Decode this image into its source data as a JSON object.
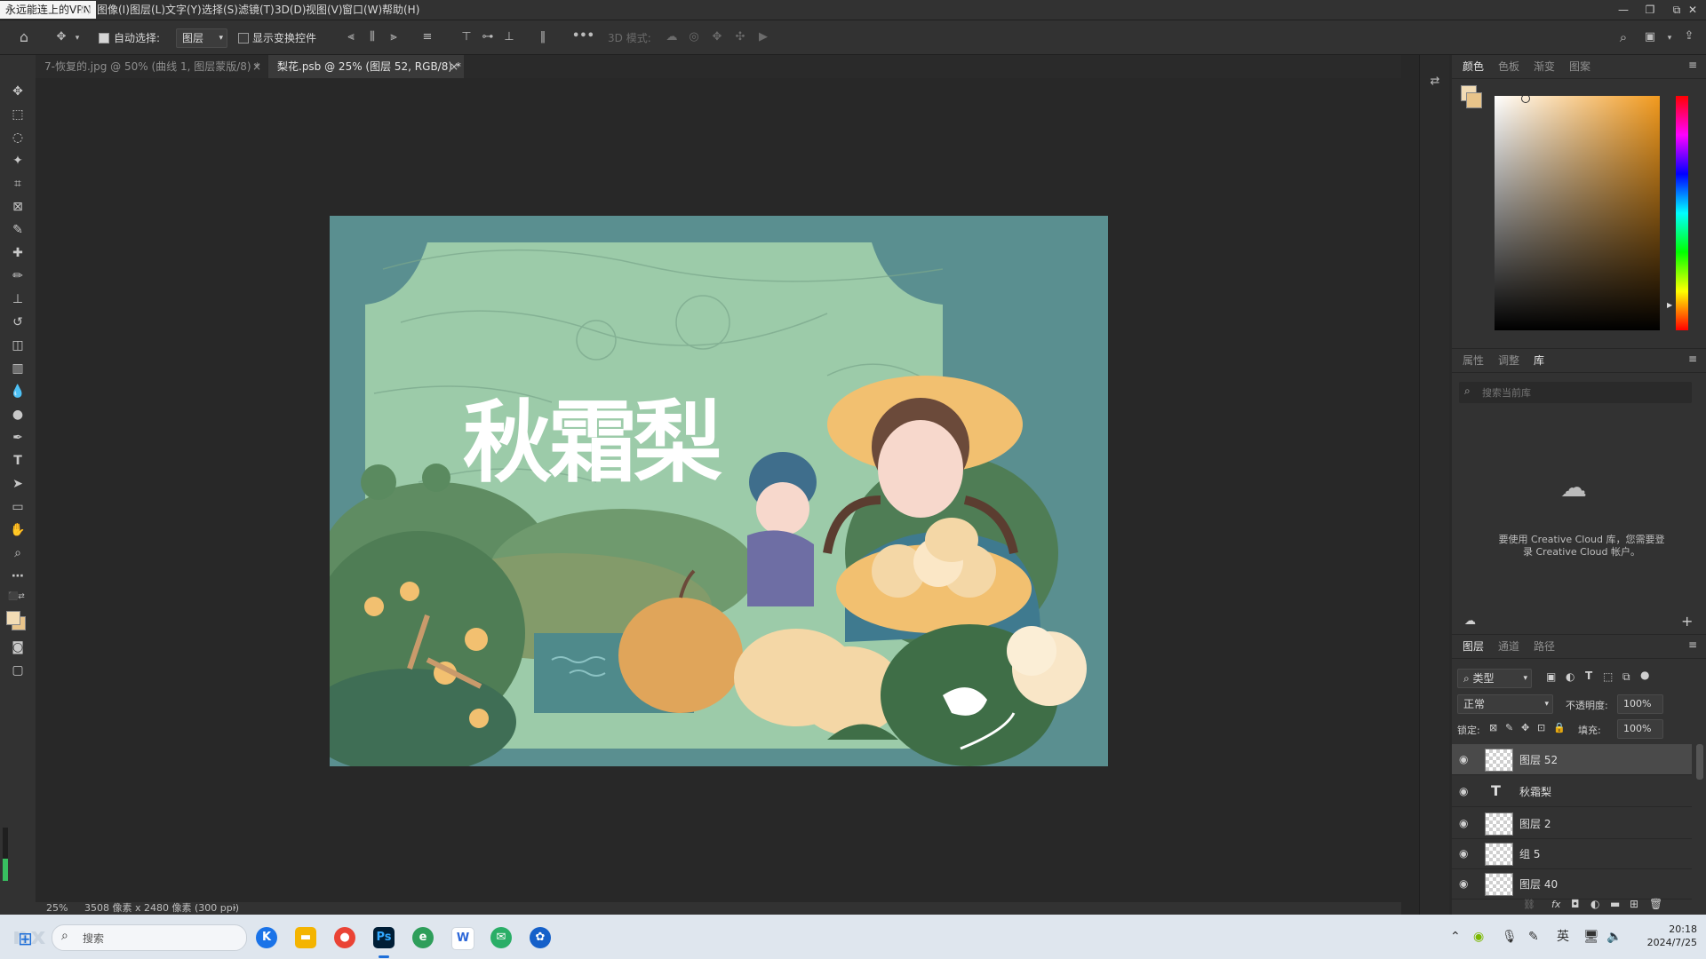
{
  "menubar": {
    "vpn_label": "永远能连上的VPN",
    "items": [
      "E)",
      "图像(I)",
      "图层(L)",
      "文字(Y)",
      "选择(S)",
      "滤镜(T)",
      "3D(D)",
      "视图(V)",
      "窗口(W)",
      "帮助(H)"
    ],
    "window_buttons": [
      "—",
      "❐",
      "⧉",
      "✕"
    ]
  },
  "options": {
    "auto_select_label": "自动选择:",
    "auto_select_checked": true,
    "target_value": "图层",
    "show_transform_label": "显示变换控件",
    "mode3d_label": "3D 模式:"
  },
  "tabs": [
    {
      "label": "7-恢复的.jpg @ 50% (曲线 1, 图层蒙版/8) *",
      "active": false
    },
    {
      "label": "梨花.psb @ 25% (图层 52, RGB/8) *",
      "active": true
    }
  ],
  "canvas": {
    "title_text": "秋霜梨",
    "colors": {
      "bg": "#5a8f90",
      "inner": "#9ccba9",
      "hill": "#4f7d55",
      "skin": "#f7d8cc",
      "hat": "#f2c070",
      "pear": "#f4d7a6",
      "shirt": "#3f7a8f"
    }
  },
  "status": {
    "zoom": "25%",
    "doc_size": "3508 像素 x 2480 像素 (300 ppi)"
  },
  "color_panel": {
    "tabs": [
      "颜色",
      "色板",
      "渐变",
      "图案"
    ],
    "fg_color": "#f2dcb5",
    "bg_color": "#e8c48a",
    "hue_color": "#f29a1e"
  },
  "library_panel": {
    "tabs": [
      "属性",
      "调整",
      "库"
    ],
    "search_placeholder": "搜索当前库",
    "message_line1": "要使用 Creative Cloud 库，您需要登",
    "message_line2": "录 Creative Cloud 帐户。"
  },
  "layers_panel": {
    "tabs": [
      "图层",
      "通道",
      "路径"
    ],
    "filter_label": "类型",
    "blend_mode": "正常",
    "opacity_label": "不透明度:",
    "opacity_value": "100%",
    "lock_label": "锁定:",
    "fill_label": "填充:",
    "fill_value": "100%",
    "layers": [
      {
        "name": "图层 52",
        "kind": "pixel",
        "selected": true
      },
      {
        "name": "秋霜梨",
        "kind": "text",
        "selected": false
      },
      {
        "name": "图层 2",
        "kind": "pixel",
        "selected": false
      },
      {
        "name": "组 5",
        "kind": "pixel",
        "selected": false
      },
      {
        "name": "图层 40",
        "kind": "pixel",
        "selected": false
      }
    ]
  },
  "taskbar": {
    "search_label": "搜索",
    "time": "20:18",
    "date": "2024/7/25",
    "lang": "英",
    "watermark": "nx"
  }
}
